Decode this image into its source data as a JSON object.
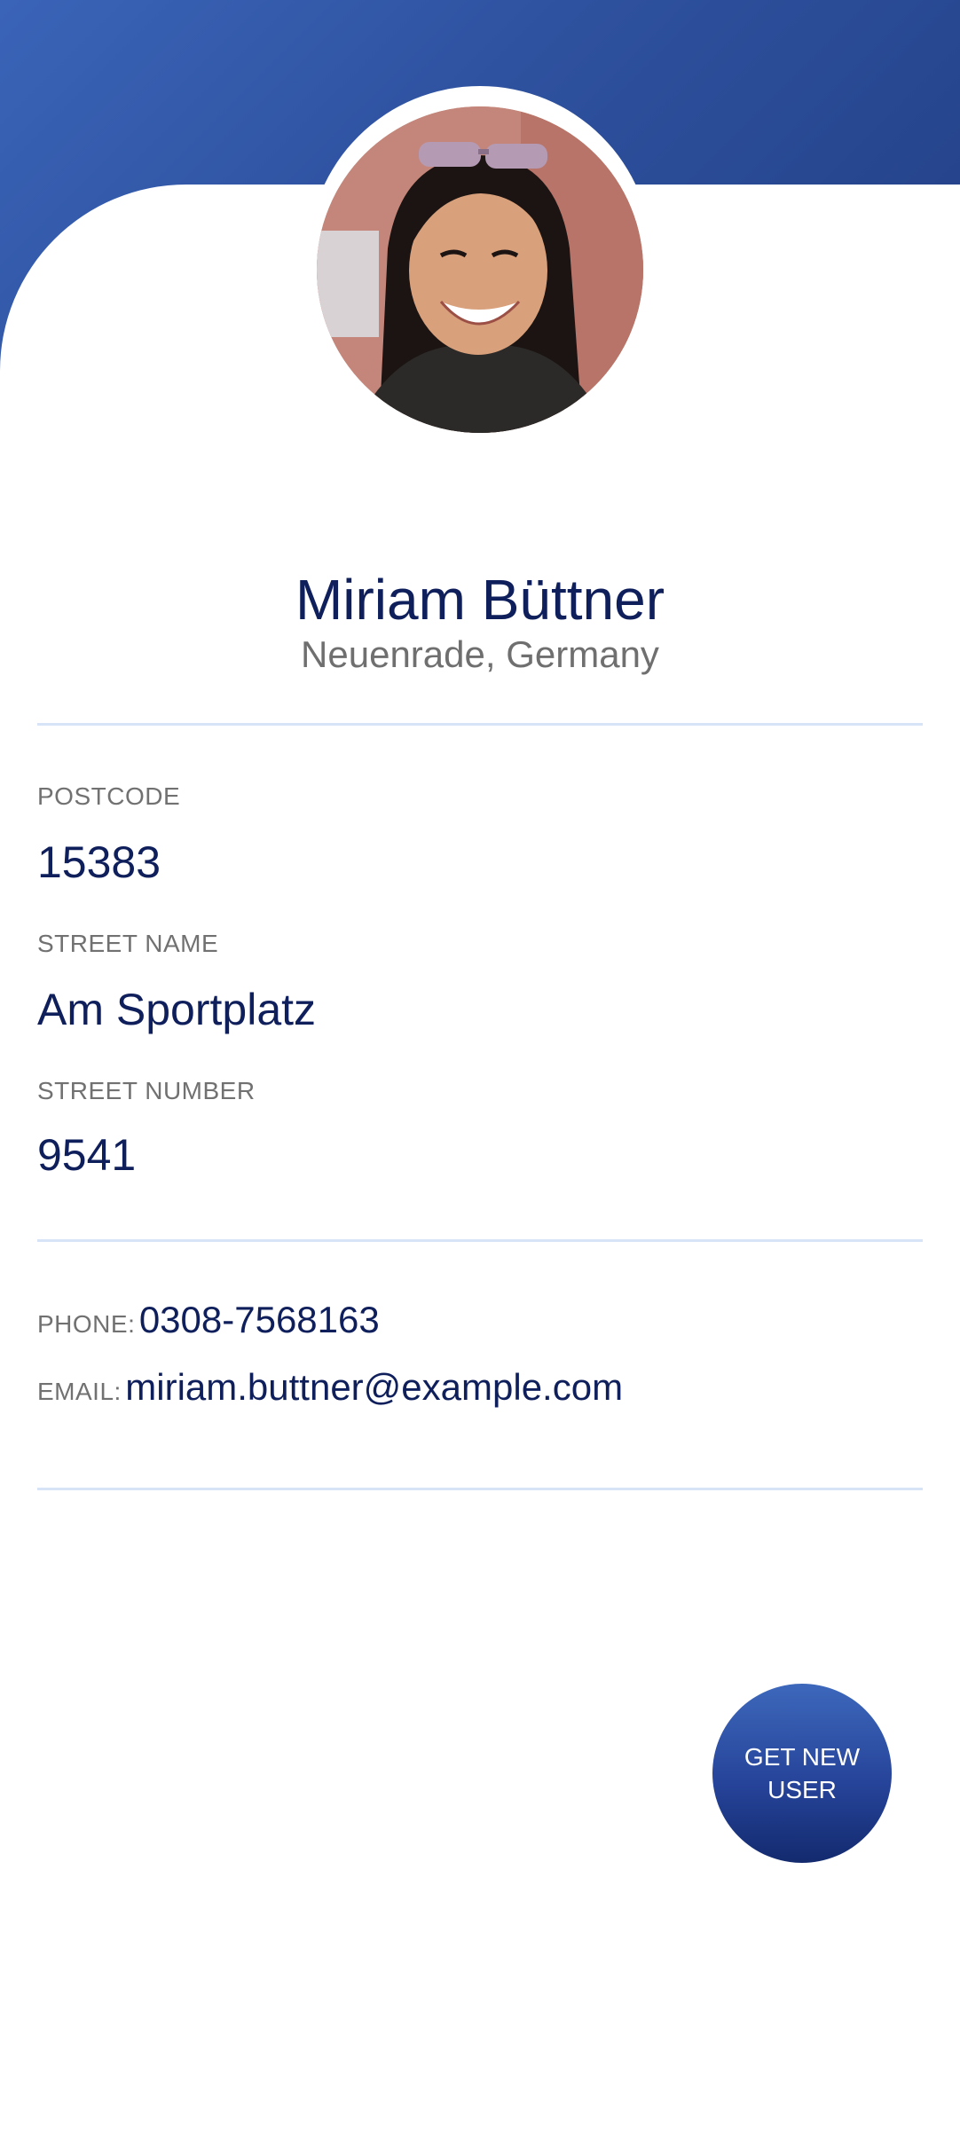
{
  "profile": {
    "name": "Miriam Büttner",
    "location": "Neuenrade, Germany"
  },
  "address": {
    "postcode_label": "POSTCODE",
    "postcode": "15383",
    "street_name_label": "STREET NAME",
    "street_name": "Am Sportplatz",
    "street_number_label": "STREET NUMBER",
    "street_number": "9541"
  },
  "contact": {
    "phone_label": "PHONE:",
    "phone": "0308-7568163",
    "email_label": "EMAIL:",
    "email": "miriam.buttner@example.com"
  },
  "actions": {
    "get_new_user_label": "GET NEW USER"
  },
  "colors": {
    "header_gradient_start": "#3a64b8",
    "header_gradient_end": "#223f86",
    "primary_text": "#0f1f5c",
    "secondary_text": "#6f6f6f",
    "divider": "#d7e3f7"
  }
}
